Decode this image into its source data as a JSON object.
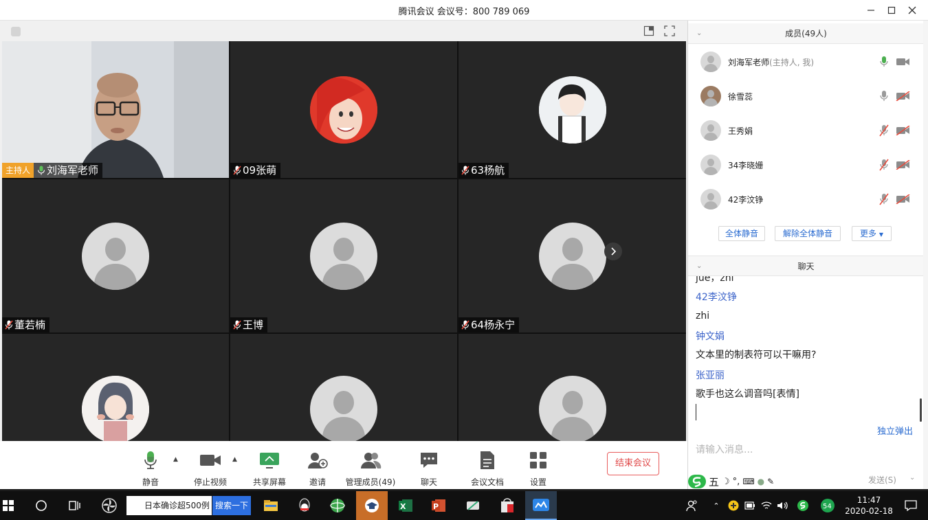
{
  "window": {
    "title": "腾讯会议 会议号：800 789 069"
  },
  "video_tiles": [
    {
      "name": "刘海军老师",
      "host_tag": "主持人",
      "mic": "on",
      "type": "camera"
    },
    {
      "name": "09张萌",
      "mic": "muted",
      "type": "avatar-mermaid"
    },
    {
      "name": "63杨航",
      "mic": "muted",
      "type": "avatar-anime-boy"
    },
    {
      "name": "董若楠",
      "mic": "muted",
      "type": "default"
    },
    {
      "name": "王博",
      "mic": "muted",
      "type": "default"
    },
    {
      "name": "64杨永宁",
      "mic": "muted",
      "type": "default"
    },
    {
      "name": "",
      "type": "avatar-anime-girl"
    },
    {
      "name": "",
      "type": "default"
    },
    {
      "name": "",
      "type": "default"
    }
  ],
  "controls": {
    "mute": "静音",
    "stop_video": "停止视频",
    "share_screen": "共享屏幕",
    "invite": "邀请",
    "manage_members": "管理成员(49)",
    "chat": "聊天",
    "meeting_docs": "会议文档",
    "settings": "设置",
    "end_meeting": "结束会议"
  },
  "members_panel": {
    "title": "成员(49人)",
    "members": [
      {
        "name": "刘海军老师",
        "role": "(主持人, 我)",
        "mic": "on",
        "camera": "on"
      },
      {
        "name": "徐雪蕊",
        "role": "",
        "mic": "on-gray",
        "camera": "off"
      },
      {
        "name": "王秀娟",
        "role": "",
        "mic": "muted",
        "camera": "off"
      },
      {
        "name": "34李晓姗",
        "role": "",
        "mic": "muted",
        "camera": "off"
      },
      {
        "name": "42李汶铮",
        "role": "",
        "mic": "muted",
        "camera": "off"
      }
    ],
    "mute_all": "全体静音",
    "unmute_all": "解除全体静音",
    "more": "更多"
  },
  "chat_panel": {
    "title": "聊天",
    "messages": [
      {
        "kind": "msg",
        "text": "jue，zhi"
      },
      {
        "kind": "name",
        "text": "42李汶铮"
      },
      {
        "kind": "msg",
        "text": "zhi"
      },
      {
        "kind": "name",
        "text": "钟文娟"
      },
      {
        "kind": "msg",
        "text": "文本里的制表符可以干嘛用?"
      },
      {
        "kind": "name",
        "text": "张亚丽"
      },
      {
        "kind": "msg",
        "text": "歌手也这么调音吗[表情]"
      }
    ],
    "popout": "独立弹出",
    "input_placeholder": "请输入消息...",
    "send": "发送(S)",
    "ime_label": "五"
  },
  "taskbar": {
    "search_text": "日本确诊超500例",
    "search_button": "搜索一下",
    "time": "11:47",
    "date": "2020-02-18",
    "badge": "54"
  },
  "colors": {
    "host_tag": "#f0a22a",
    "accent_blue": "#2a6bd0",
    "end_red": "#e04848",
    "chat_name": "#3b63c9"
  }
}
